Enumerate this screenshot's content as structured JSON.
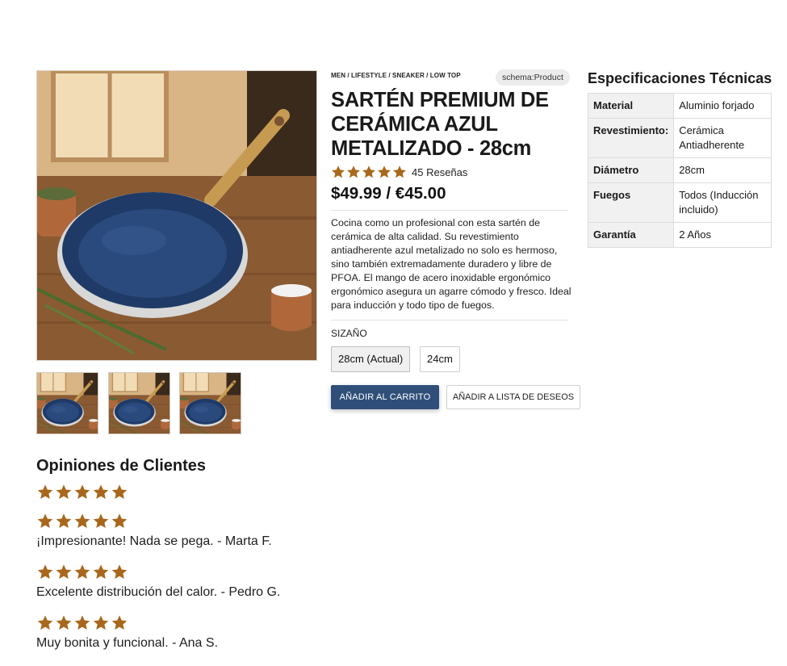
{
  "breadcrumb": "MEN / LIFESTYLE / SNEAKER / LOW TOP",
  "schema_badge": "schema:Product",
  "product": {
    "title": "SARTÉN PREMIUM DE CERÁMICA AZUL METALIZADO - 28cm",
    "rating": 5,
    "reviews_count": "45 Reseñas",
    "price": "$49.99 / €45.00",
    "description": "Cocina como un profesional con esta sartén de cerámica de alta calidad. Su revestimiento antiadherente azul metalizado no solo es hermoso, sino también extremadamente duradero y libre de PFOA. El mango de acero inoxidable ergonómico ergonómico asegura un agarre cómodo y fresco. Ideal para inducción y todo tipo de fuegos.",
    "size_label": "SIZAÑO",
    "sizes": [
      "28cm (Actual)",
      "24cm"
    ],
    "add_to_cart": "AÑADIR AL CARRITO",
    "add_to_wishlist": "AÑADIR A LISTA DE DESEOS"
  },
  "specs": {
    "title": "Especificaciones Técnicas",
    "rows": [
      {
        "key": "Material",
        "value": "Aluminio forjado"
      },
      {
        "key": "Revestimiento:",
        "value": "Cerámica Antiadherente"
      },
      {
        "key": "Diámetro",
        "value": "28cm"
      },
      {
        "key": "Fuegos",
        "value": "Todos (Inducción incluido)"
      },
      {
        "key": "Garantía",
        "value": "2 Años"
      }
    ]
  },
  "reviews": {
    "title": "Opiniones de Clientes",
    "overall_rating": 5,
    "items": [
      {
        "rating": 5,
        "text": "¡Impresionante! Nada se pega. - Marta F."
      },
      {
        "rating": 5,
        "text": "Excelente distribución del calor. - Pedro G."
      },
      {
        "rating": 5,
        "text": "Muy bonita y funcional. - Ana S."
      }
    ]
  },
  "colors": {
    "accent": "#2f4f7a",
    "star": "#a8671c",
    "pan": "#1f3a66"
  }
}
